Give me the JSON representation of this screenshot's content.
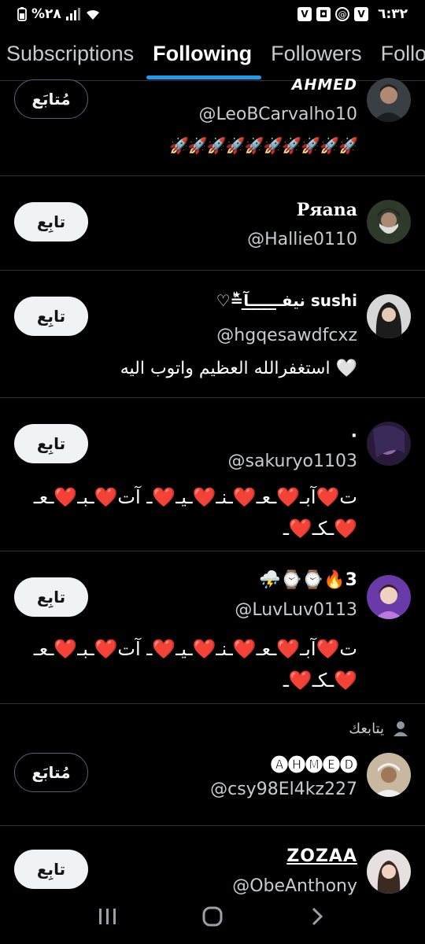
{
  "status_bar": {
    "time": "٦:٣٢",
    "battery": "%٢٨",
    "icons": [
      "v-notification-icon",
      "voicemail-icon",
      "at-icon",
      "v-notification-icon",
      "wifi-icon",
      "signal-icon",
      "battery-icon"
    ]
  },
  "tabs": [
    {
      "label": "Subscriptions",
      "active": false
    },
    {
      "label": "Following",
      "active": true
    },
    {
      "label": "Followers",
      "active": false
    },
    {
      "label": "Follo",
      "active": false
    }
  ],
  "accent_color": "#1d9bf0",
  "users": [
    {
      "name": "𝘼𝙃𝙈𝙀𝘿",
      "handle": "@LeoBCarvalho10",
      "bio": "🚀🚀🚀🚀🚀🚀🚀🚀🚀🚀",
      "button": "مُتابَع"
    },
    {
      "name": "Pяana",
      "handle": "@Hallie0110",
      "bio": "",
      "button": "تابِع"
    },
    {
      "name": "♡≛ٰنيفـ̲ـ̲ـ̲ـ̲ـ̲ـ̲آ sushi",
      "handle": "@hgqesawdfcxz",
      "bio": "استغفرالله العظيم واتوب اليه 🤍",
      "button": "تابِع"
    },
    {
      "name": "·",
      "handle": "@sakuryo1103",
      "bio": "ت❤️آبـ❤️ـعـ❤️ـنـ❤️ـيـ❤️ـ آت❤️ـبـ❤️ـعـ❤️ـكـ❤️ـ",
      "button": "تابِع"
    },
    {
      "name": "⛈️⌚⌚🔥3",
      "handle": "@LuvLuv0113",
      "bio": "ت❤️آبـ❤️ـعـ❤️ـنـ❤️ـيـ❤️ـ آت❤️ـبـ❤️ـعـ❤️ـكـ❤️ـ",
      "button": "تابِع"
    },
    {
      "follows_you": "يتابعك",
      "name": "🅐🅗🅜🅔🅓",
      "handle": "@csy98El4kz227",
      "bio": "",
      "button": "مُتابَع"
    },
    {
      "name": "ZOZAA",
      "handle": "@ObeAnthony",
      "bio": "",
      "button": "تابِع"
    }
  ],
  "nav_bar": [
    "recent-apps-icon",
    "home-icon",
    "back-icon"
  ]
}
